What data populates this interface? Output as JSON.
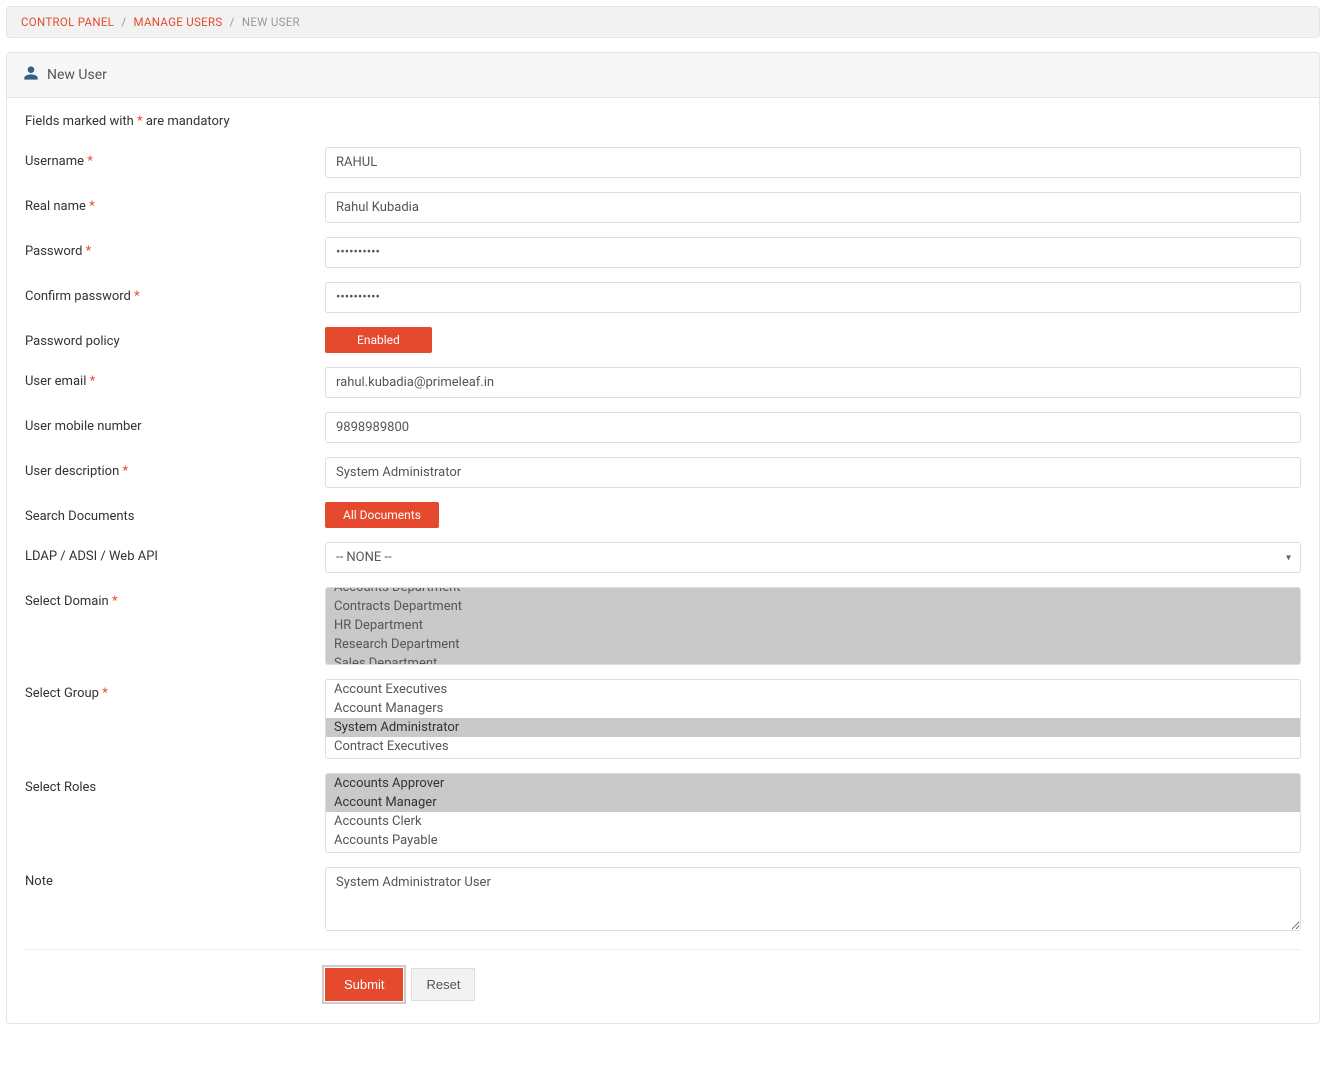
{
  "breadcrumb": {
    "items": [
      "CONTROL PANEL",
      "MANAGE USERS",
      "NEW USER"
    ]
  },
  "panel": {
    "title": "New User"
  },
  "mandatory_note_pre": "Fields marked with ",
  "mandatory_note_post": " are mandatory",
  "star": "*",
  "labels": {
    "username": "Username",
    "realname": "Real name",
    "password": "Password",
    "confirm": "Confirm password",
    "policy": "Password policy",
    "email": "User email",
    "mobile": "User mobile number",
    "desc": "User description",
    "search": "Search Documents",
    "ldap": "LDAP / ADSI / Web API",
    "domain": "Select Domain",
    "group": "Select Group",
    "roles": "Select Roles",
    "note": "Note"
  },
  "values": {
    "username": "RAHUL",
    "realname": "Rahul Kubadia",
    "password": "••••••••••",
    "confirm": "••••••••••",
    "email": "rahul.kubadia@primeleaf.in",
    "mobile": "9898989800",
    "desc": "System Administrator",
    "ldap": "-- NONE --",
    "note": "System Administrator User"
  },
  "buttons": {
    "policy": "Enabled",
    "search": "All Documents",
    "submit": "Submit",
    "reset": "Reset"
  },
  "domain_options": [
    "Accounts Department",
    "Contracts Department",
    "HR Department",
    "Research Department",
    "Sales Department"
  ],
  "group_options": [
    "Account Executives",
    "Account Managers",
    "System Administrator",
    "Contract Executives"
  ],
  "group_selected_index": 2,
  "roles_options": [
    "Accounts Approver",
    "Account Manager",
    "Accounts Clerk",
    "Accounts Payable"
  ],
  "roles_selected_indices": [
    0,
    1
  ]
}
